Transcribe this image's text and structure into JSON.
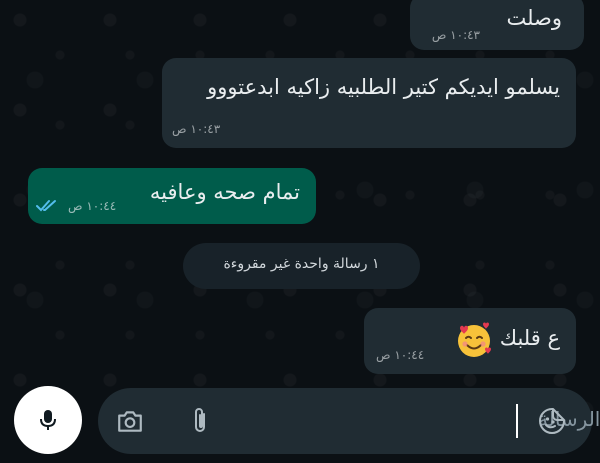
{
  "messages": [
    {
      "text": "وصلت",
      "time": "١٠:٤٣ ص",
      "direction": "incoming"
    },
    {
      "text": "يسلمو ايديكم كتير الطلبيه زاكيه ابدعتووو",
      "time": "١٠:٤٣ ص",
      "direction": "incoming"
    },
    {
      "text": "تمام صحه وعافيه",
      "time": "١٠:٤٤ ص",
      "direction": "outgoing",
      "status": "read"
    },
    {
      "text": "ع قلبك",
      "time": "١٠:٤٤ ص",
      "direction": "incoming",
      "emoji": "smiling-face-with-hearts"
    }
  ],
  "unread_divider": "١ رسالة واحدة غير مقروءة",
  "composer": {
    "placeholder": "الرسالة",
    "icons": [
      "mic-icon",
      "camera-icon",
      "attach-icon",
      "sticker-icon"
    ]
  },
  "colors": {
    "background": "#0b1014",
    "incoming_bubble": "#202c33",
    "outgoing_bubble": "#005c4b",
    "read_ticks": "#53bdeb"
  }
}
